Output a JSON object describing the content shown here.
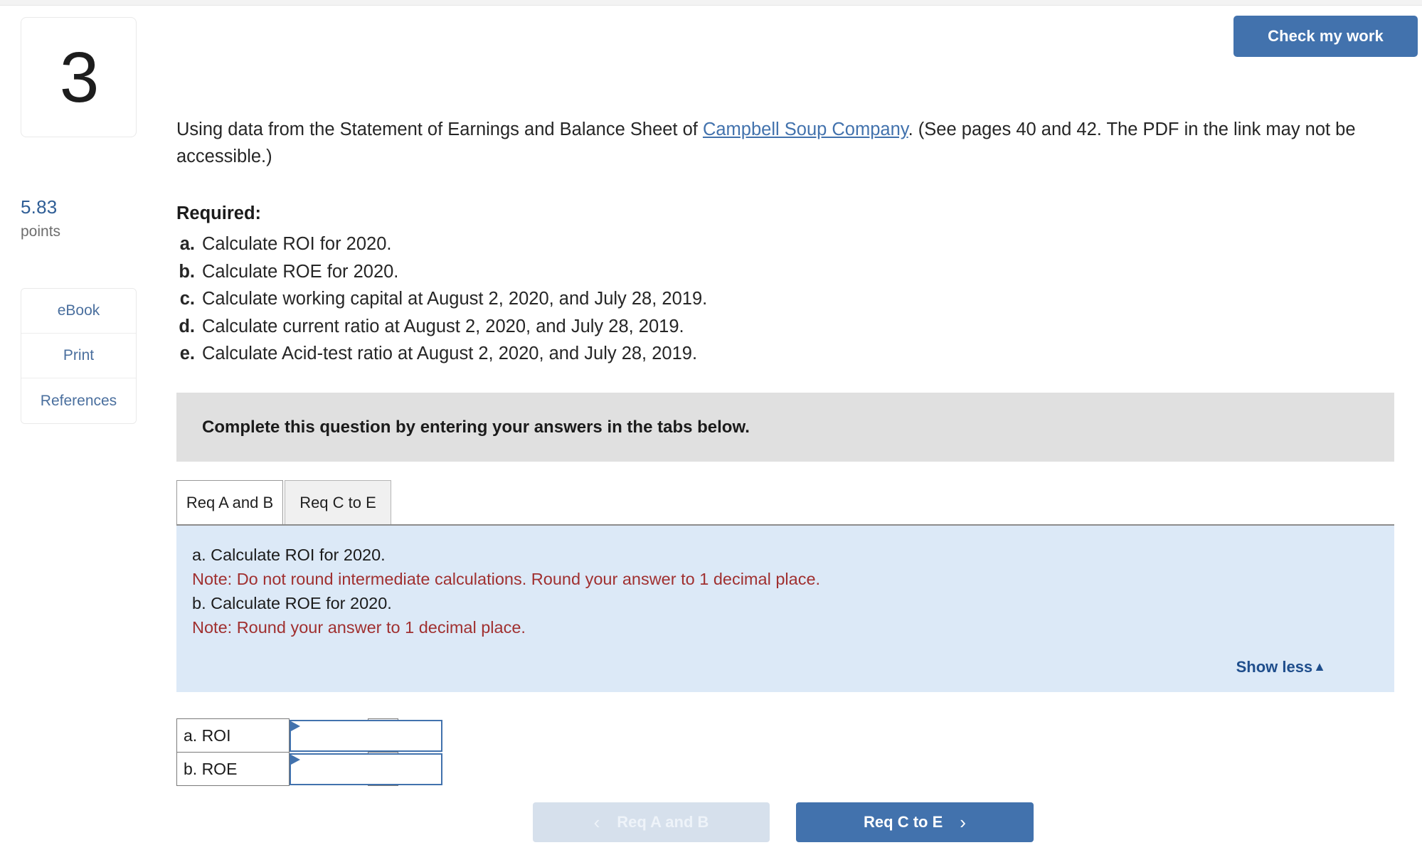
{
  "question": {
    "number": "3",
    "points_value": "5.83",
    "points_label": "points"
  },
  "tools": {
    "ebook": "eBook",
    "print": "Print",
    "references": "References"
  },
  "header": {
    "check_my_work": "Check my work"
  },
  "intro": {
    "before_link": "Using data from the Statement of Earnings and Balance Sheet of ",
    "link_text": "Campbell Soup Company",
    "after_link": ". (See pages 40 and 42. The PDF in the link may not be accessible.)"
  },
  "required": {
    "heading": "Required:",
    "items": [
      {
        "letter": "a.",
        "text": "Calculate ROI for 2020."
      },
      {
        "letter": "b.",
        "text": "Calculate ROE for 2020."
      },
      {
        "letter": "c.",
        "text": "Calculate working capital at August 2, 2020, and July 28, 2019."
      },
      {
        "letter": "d.",
        "text": "Calculate current ratio at August 2, 2020, and July 28, 2019."
      },
      {
        "letter": "e.",
        "text": "Calculate Acid-test ratio at August 2, 2020, and July 28, 2019."
      }
    ]
  },
  "instruction_band": {
    "text": "Complete this question by entering your answers in the tabs below."
  },
  "tabs": [
    {
      "label": "Req A and B",
      "active": true
    },
    {
      "label": "Req C to E",
      "active": false
    }
  ],
  "panel": {
    "line_a": "a. Calculate ROI for 2020.",
    "note_a": "Note: Do not round intermediate calculations. Round your answer to 1 decimal place.",
    "line_b": "b. Calculate ROE for 2020.",
    "note_b": "Note: Round your answer to 1 decimal place.",
    "show_less": "Show less",
    "show_less_caret": "▲"
  },
  "answers": {
    "rows": [
      {
        "label": "a. ROI",
        "value": "",
        "unit": "%"
      },
      {
        "label": "b. ROE",
        "value": "",
        "unit": "%"
      }
    ]
  },
  "nav": {
    "prev_label": "Req A and B",
    "prev_chevron": "‹",
    "next_label": "Req C to E",
    "next_chevron": "›"
  },
  "colors": {
    "accent_blue": "#4272ad",
    "link_blue": "#4272ad",
    "note_red": "#a03030",
    "panel_blue": "#dce9f7",
    "band_gray": "#e0e0e0",
    "points_blue": "#2f5e96"
  }
}
